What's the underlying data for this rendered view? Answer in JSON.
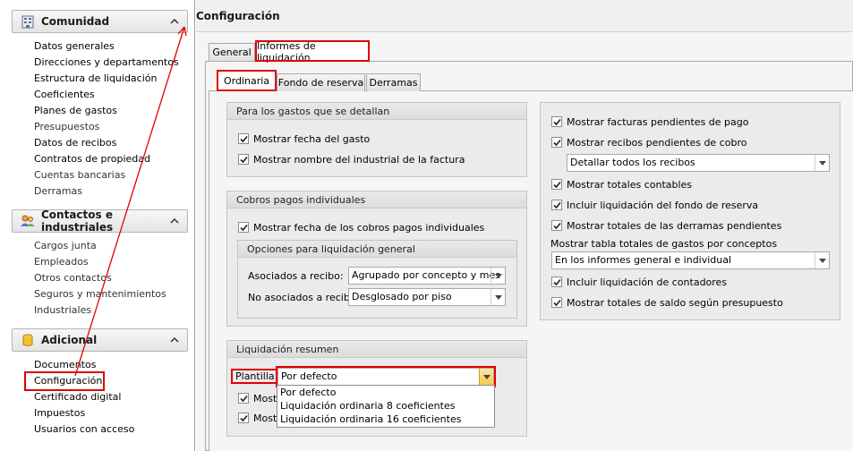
{
  "sidebar": {
    "groups": [
      {
        "title": "Comunidad",
        "items": [
          "Datos generales",
          "Direcciones y departamentos",
          "Estructura de liquidación",
          "Coeficientes",
          "Planes de gastos",
          "Presupuestos",
          "Datos de recibos",
          "Contratos de propiedad",
          "Cuentas bancarias",
          "Derramas"
        ]
      },
      {
        "title": "Contactos e industriales",
        "items": [
          "Cargos junta",
          "Empleados",
          "Otros contactos",
          "Seguros y mantenimientos",
          "Industriales"
        ]
      },
      {
        "title": "Adicional",
        "items": [
          "Documentos",
          "Configuración",
          "Certificado digital",
          "Impuestos",
          "Usuarios con acceso"
        ]
      }
    ]
  },
  "main": {
    "title": "Configuración",
    "tabs": [
      "General",
      "Informes de liquidación"
    ],
    "subtabs": [
      "Ordinaria",
      "Fondo de reserva",
      "Derramas"
    ]
  },
  "gastos_panel": {
    "title": "Para los gastos que se detallan",
    "options": [
      "Mostrar fecha del gasto",
      "Mostrar nombre del industrial de la factura"
    ]
  },
  "cobros_panel": {
    "title": "Cobros pagos individuales",
    "option": "Mostrar fecha de los cobros pagos individuales",
    "sub_title": "Opciones para liquidación general",
    "asociados_label": "Asociados a recibo:",
    "asociados_value": "Agrupado por concepto y mes",
    "no_asociados_label": "No asociados a recibo:",
    "no_asociados_value": "Desglosado por piso"
  },
  "resumen_panel": {
    "title": "Liquidación resumen",
    "plantilla_label": "Plantilla:",
    "plantilla_value": "Por defecto",
    "options_partial": [
      "Mostr",
      "Mostr"
    ],
    "dropdown_options": [
      "Por defecto",
      "Liquidación ordinaria 8 coeficientes",
      "Liquidación ordinaria 16 coeficientes"
    ]
  },
  "right_panel": {
    "opt1": "Mostrar facturas pendientes de pago",
    "opt2": "Mostrar recibos pendientes de cobro",
    "recibos_combo": "Detallar todos los recibos",
    "opt3": "Mostrar totales contables",
    "opt4": "Incluir liquidación del fondo de reserva",
    "opt5": "Mostrar totales de las derramas pendientes",
    "tabla_label": "Mostrar tabla totales de gastos por conceptos",
    "tabla_combo": "En los informes general e individual",
    "opt6": "Incluir liquidación de contadores",
    "opt7": "Mostrar totales de saldo según presupuesto"
  },
  "colors": {
    "highlight": "#e00000",
    "panel_bg": "#ebebeb",
    "dropdown_arrow": "#f7c94c"
  }
}
